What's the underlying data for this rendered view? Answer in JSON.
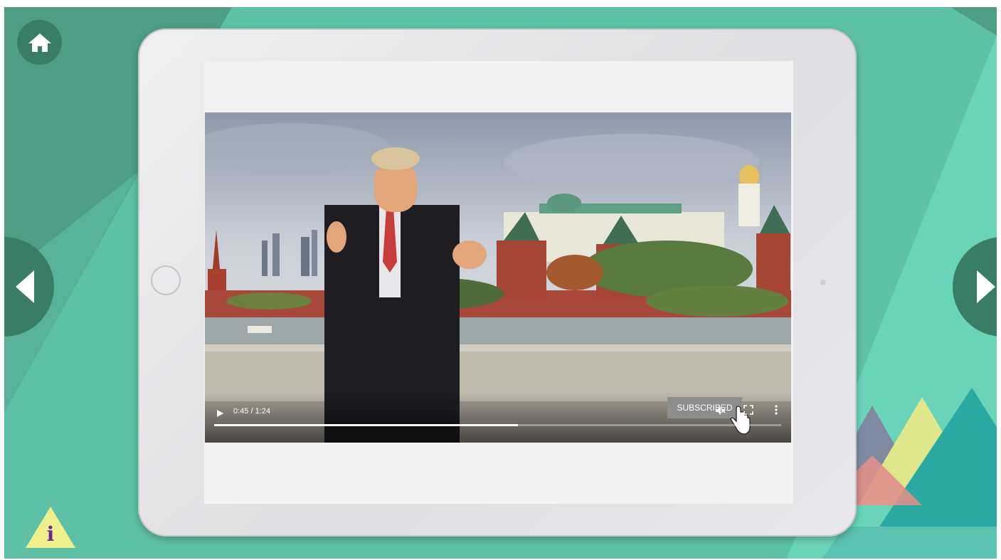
{
  "background": {
    "base_color": "#5ec1a5",
    "dark_color": "#3a7d67"
  },
  "navigation": {
    "home_icon": "home-icon",
    "prev_icon": "chevron-left-icon",
    "next_icon": "chevron-right-icon",
    "info_label": "i"
  },
  "video": {
    "current_time": "0:45",
    "duration": "1:24",
    "time_display": "0:45 / 1:24",
    "progress": 0.536,
    "subscribe_label": "SUBSCRIBED",
    "play_icon": "play-icon",
    "mute_icon": "mute-icon",
    "fullscreen_icon": "fullscreen-icon",
    "more_icon": "more-vertical-icon"
  }
}
